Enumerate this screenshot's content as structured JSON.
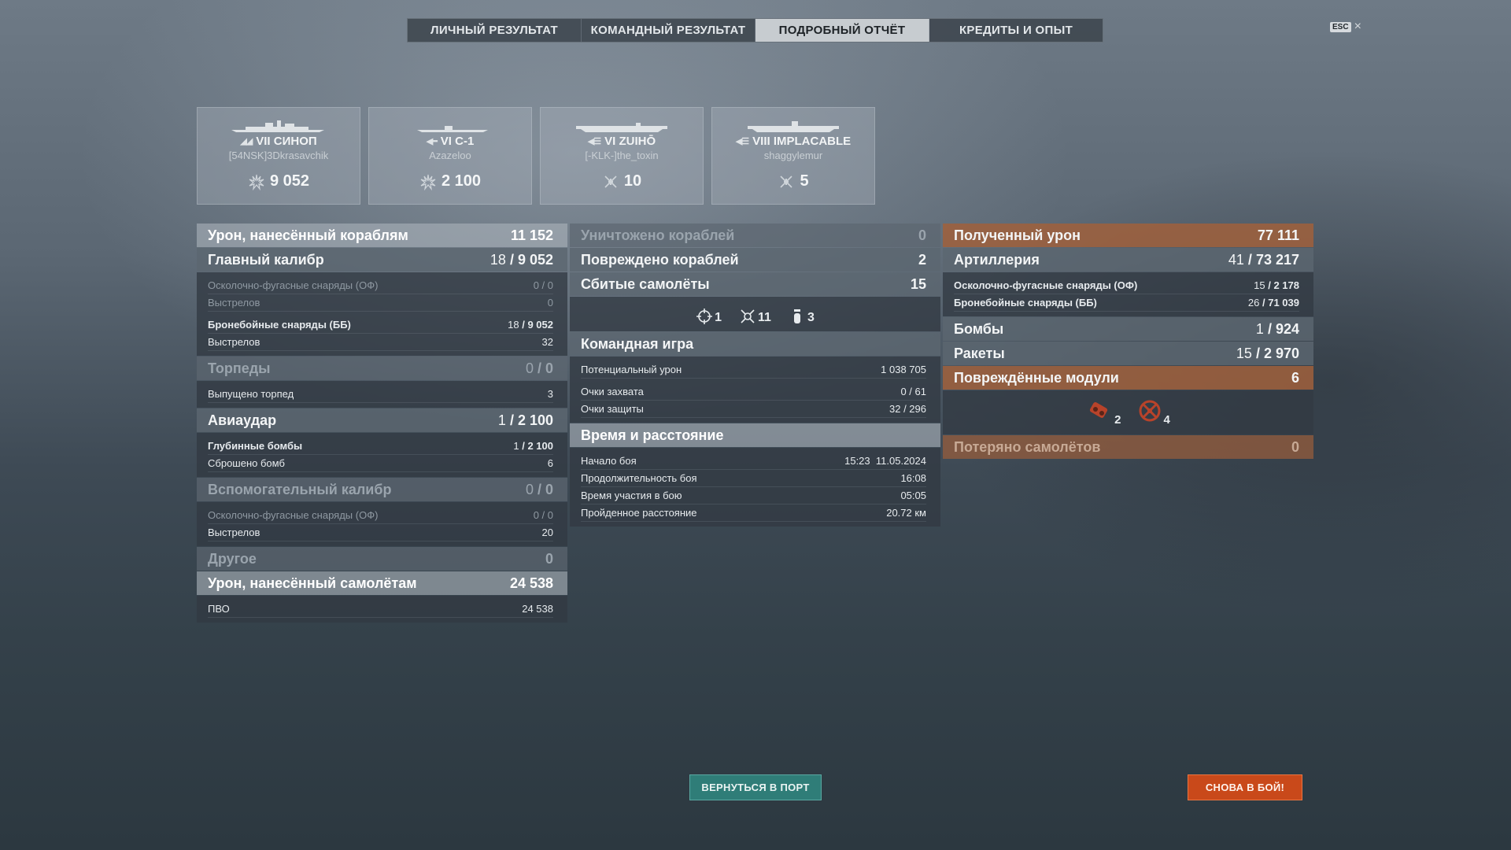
{
  "tabs": [
    {
      "label": "ЛИЧНЫЙ РЕЗУЛЬТАТ",
      "active": false
    },
    {
      "label": "КОМАНДНЫЙ РЕЗУЛЬТАТ",
      "active": false
    },
    {
      "label": "ПОДРОБНЫЙ ОТЧЁТ",
      "active": true
    },
    {
      "label": "КРЕДИТЫ И ОПЫТ",
      "active": false
    }
  ],
  "esc": {
    "key": "ESC",
    "close": "×"
  },
  "ships": [
    {
      "tier_name": "VII СИНОП",
      "player": "[54NSK]3Dkrasavchik",
      "value": "9 052",
      "icon": "damage-burst-icon"
    },
    {
      "tier_name": "VI C-1",
      "player": "Azazeloo",
      "value": "2 100",
      "icon": "damage-burst-icon"
    },
    {
      "tier_name": "VI ZUIHŌ",
      "player": "[-KLK-]the_toxin",
      "value": "10",
      "icon": "plane-shot-down-icon"
    },
    {
      "tier_name": "VIII IMPLACABLE",
      "player": "shaggylemur",
      "value": "5",
      "icon": "plane-shot-down-icon"
    }
  ],
  "col1": {
    "ship_damage": {
      "label": "Урон, нанесённый кораблям",
      "value": "11 152"
    },
    "main_battery": {
      "label": "Главный калибр",
      "a": "18",
      "b": "9 052"
    },
    "mb_he": {
      "label": "Осколочно-фугасные снаряды (ОФ)",
      "a": "0",
      "b": "0"
    },
    "mb_he_shots": {
      "label": "Выстрелов",
      "value": "0"
    },
    "mb_ap": {
      "label": "Бронебойные снаряды (ББ)",
      "a": "18",
      "b": "9 052"
    },
    "mb_ap_shots": {
      "label": "Выстрелов",
      "value": "32"
    },
    "torpedoes": {
      "label": "Торпеды",
      "a": "0",
      "b": "0"
    },
    "torp_fired": {
      "label": "Выпущено торпед",
      "value": "3"
    },
    "airstrike": {
      "label": "Авиаудар",
      "a": "1",
      "b": "2 100"
    },
    "depth_charges": {
      "label": "Глубинные бомбы",
      "a": "1",
      "b": "2 100"
    },
    "bombs_dropped": {
      "label": "Сброшено бомб",
      "value": "6"
    },
    "secondary": {
      "label": "Вспомогательный калибр",
      "a": "0",
      "b": "0"
    },
    "sec_he": {
      "label": "Осколочно-фугасные снаряды (ОФ)",
      "a": "0",
      "b": "0"
    },
    "sec_shots": {
      "label": "Выстрелов",
      "value": "20"
    },
    "other": {
      "label": "Другое",
      "value": "0"
    },
    "plane_damage": {
      "label": "Урон, нанесённый самолётам",
      "value": "24 538"
    },
    "aa": {
      "label": "ПВО",
      "value": "24 538"
    }
  },
  "col2": {
    "destroyed": {
      "label": "Уничтожено кораблей",
      "value": "0"
    },
    "damaged": {
      "label": "Повреждено кораблей",
      "value": "2"
    },
    "planes_shot": {
      "label": "Сбитые самолёты",
      "value": "15"
    },
    "plane_icons": [
      {
        "icon": "crosshair-icon",
        "value": "1"
      },
      {
        "icon": "fighter-plane-icon",
        "value": "11"
      },
      {
        "icon": "bomb-icon",
        "value": "3"
      }
    ],
    "team_play": {
      "label": "Командная игра"
    },
    "potential": {
      "label": "Потенциальный урон",
      "value": "1 038 705"
    },
    "capture": {
      "label": "Очки захвата",
      "a": "0",
      "b": "61"
    },
    "defense": {
      "label": "Очки защиты",
      "a": "32",
      "b": "296"
    },
    "time_distance": {
      "label": "Время и расстояние"
    },
    "start": {
      "label": "Начало боя",
      "time": "15:23",
      "date": "11.05.2024"
    },
    "duration": {
      "label": "Продолжительность боя",
      "value": "16:08"
    },
    "participation": {
      "label": "Время участия в бою",
      "value": "05:05"
    },
    "distance": {
      "label": "Пройденное расстояние",
      "value": "20.72 км"
    }
  },
  "col3": {
    "received": {
      "label": "Полученный урон",
      "value": "77 111"
    },
    "artillery": {
      "label": "Артиллерия",
      "a": "41",
      "b": "73 217"
    },
    "rec_he": {
      "label": "Осколочно-фугасные снаряды (ОФ)",
      "a": "15",
      "b": "2 178"
    },
    "rec_ap": {
      "label": "Бронебойные снаряды (ББ)",
      "a": "26",
      "b": "71 039"
    },
    "bombs": {
      "label": "Бомбы",
      "a": "1",
      "b": "924"
    },
    "rockets": {
      "label": "Ракеты",
      "a": "15",
      "b": "2 970"
    },
    "modules": {
      "label": "Повреждённые модули",
      "value": "6"
    },
    "module_icons": [
      {
        "icon": "engine-module-icon",
        "value": "2"
      },
      {
        "icon": "steering-module-icon",
        "value": "4"
      }
    ],
    "planes_lost": {
      "label": "Потеряно самолётов",
      "value": "0"
    }
  },
  "buttons": {
    "port": "ВЕРНУТЬСЯ В ПОРТ",
    "battle": "СНОВА В БОЙ!"
  },
  "colors": {
    "accent_teal": "#2f7d78",
    "accent_orange": "#c9491a",
    "damage_received": "#a0603c"
  }
}
